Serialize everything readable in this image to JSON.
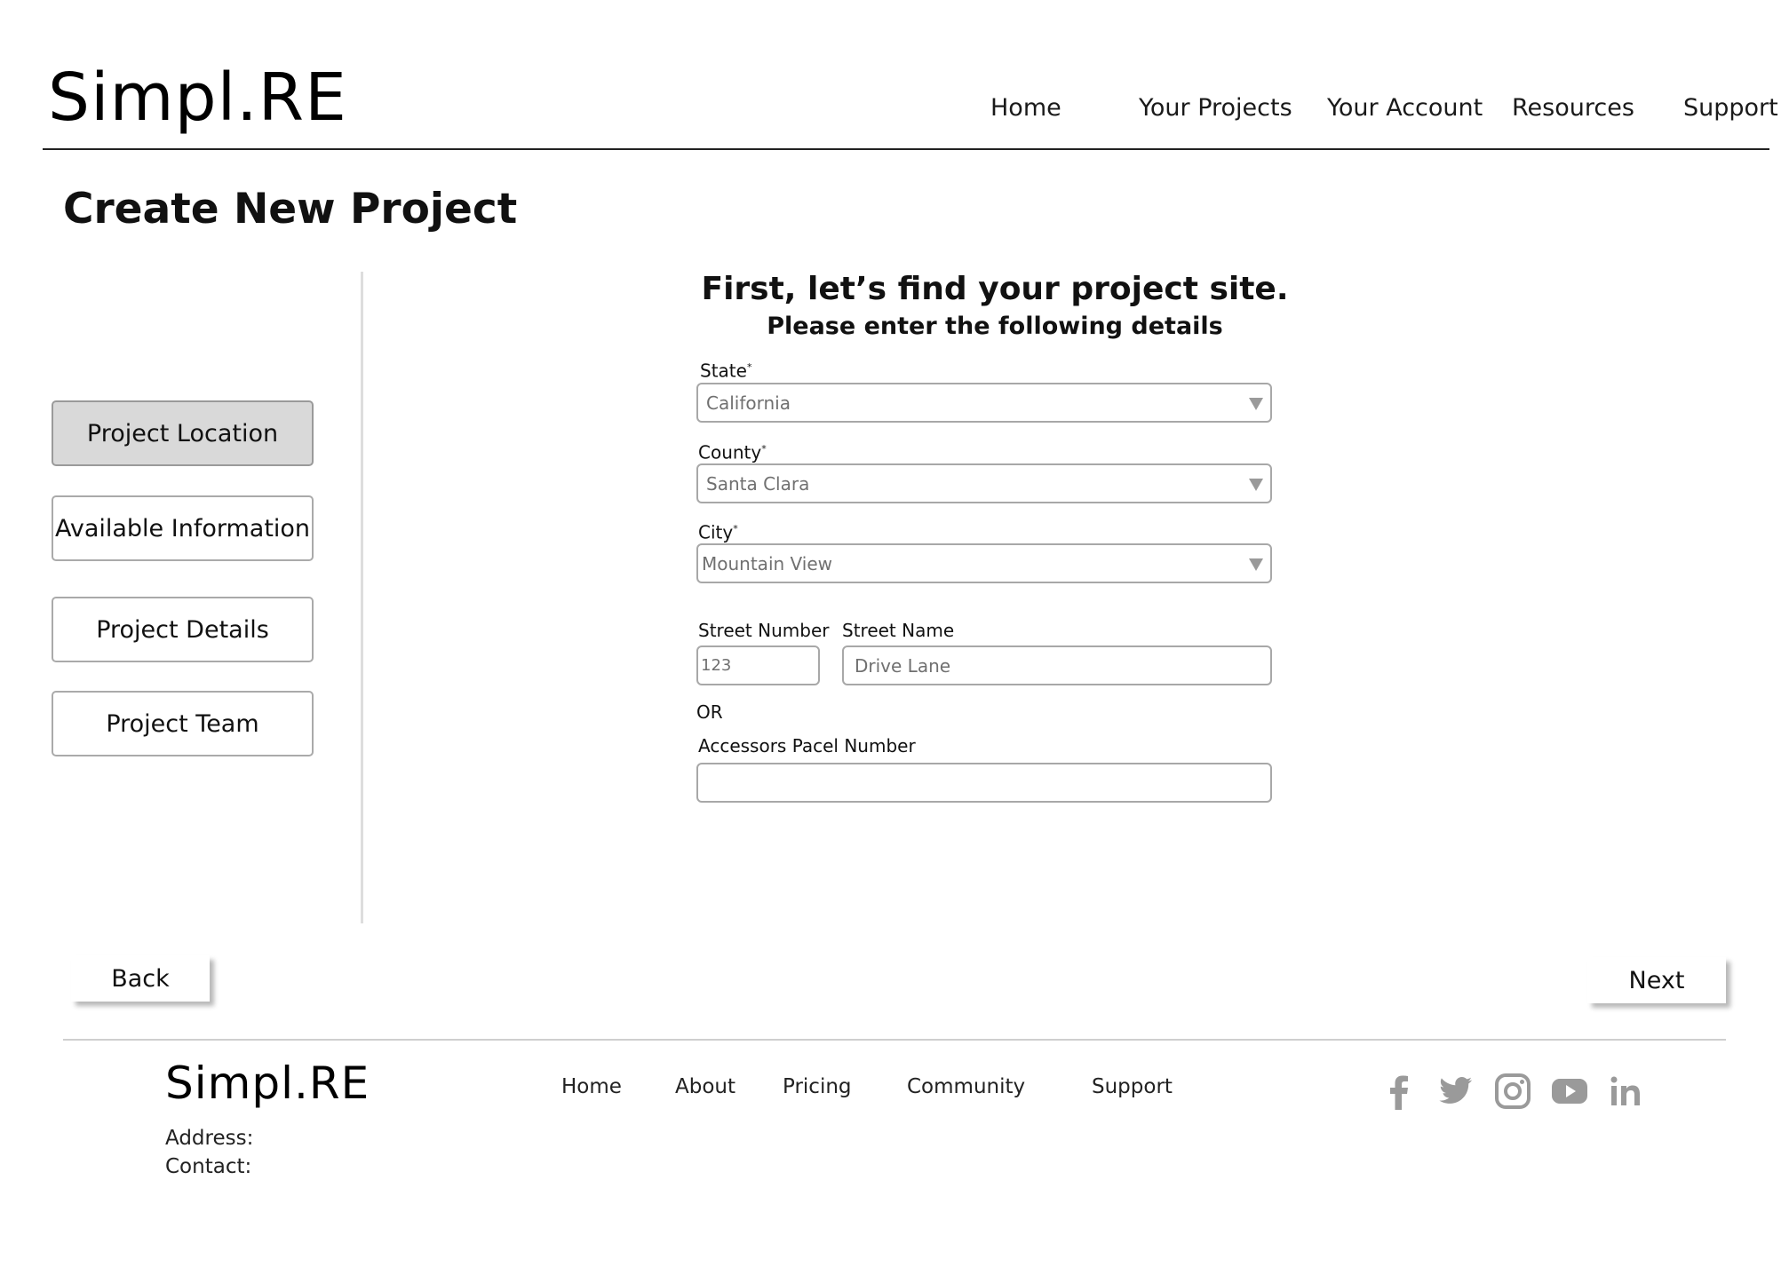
{
  "header": {
    "logo": "Simpl.RE",
    "nav": [
      "Home",
      "Your Projects",
      "Your Account",
      "Resources",
      "Support"
    ]
  },
  "page_title": "Create New Project",
  "sidebar": {
    "items": [
      {
        "label": "Project Location",
        "active": true
      },
      {
        "label": "Available Information",
        "active": false
      },
      {
        "label": "Project Details",
        "active": false
      },
      {
        "label": "Project Team",
        "active": false
      }
    ]
  },
  "form": {
    "heading": "First, let’s find your project site.",
    "subheading": "Please enter the following details",
    "state": {
      "label": "State",
      "required_mark": "*",
      "value": "California"
    },
    "county": {
      "label": "County",
      "required_mark": "*",
      "value": "Santa Clara"
    },
    "city": {
      "label": "City",
      "required_mark": "*",
      "value": "Mountain View"
    },
    "street_number": {
      "label": "Street Number",
      "value": "123"
    },
    "street_name": {
      "label": "Street Name",
      "value": "Drive Lane"
    },
    "or_text": "OR",
    "parcel": {
      "label": "Accessors Pacel Number",
      "value": ""
    }
  },
  "actions": {
    "back": "Back",
    "next": "Next"
  },
  "footer": {
    "logo": "Simpl.RE",
    "links": [
      "Home",
      "About",
      "Pricing",
      "Community",
      "Support"
    ],
    "address_label": "Address:",
    "contact_label": "Contact:",
    "social_icons": [
      "facebook-icon",
      "twitter-icon",
      "instagram-icon",
      "youtube-icon",
      "linkedin-icon"
    ],
    "icon_color": "#9a9a9a"
  }
}
